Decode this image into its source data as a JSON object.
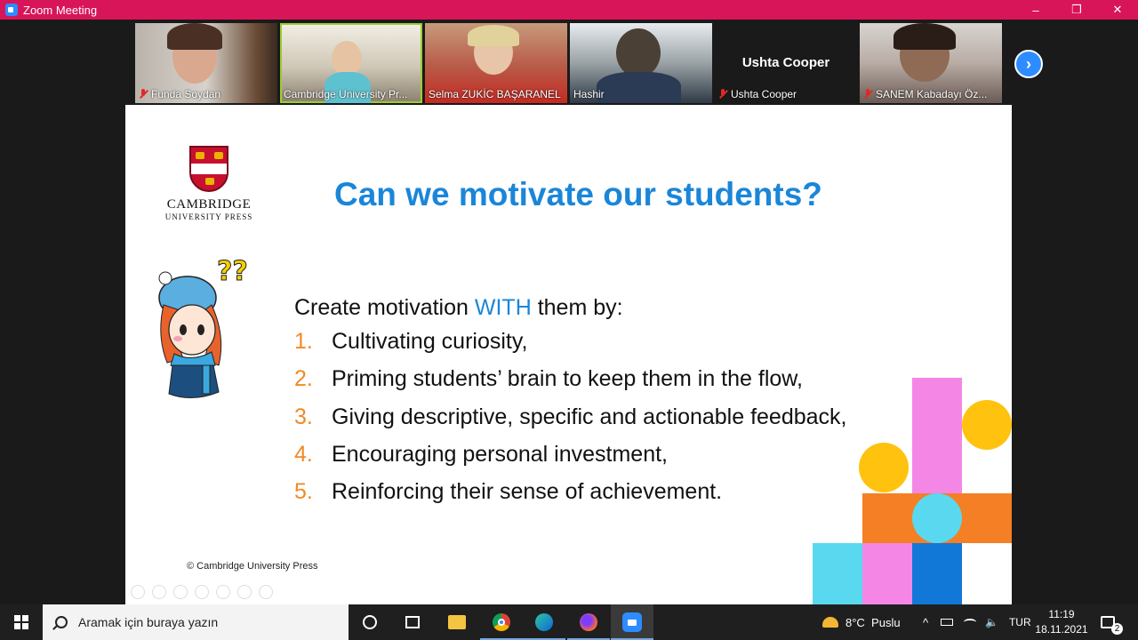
{
  "window": {
    "title": "Zoom Meeting",
    "controls": [
      "–",
      "❐",
      "✕"
    ]
  },
  "participants": [
    {
      "name": "Funda Soydan",
      "muted": true
    },
    {
      "name": "Cambridge University Pr...",
      "muted": false,
      "active": true
    },
    {
      "name": "Selma ZUKİC BAŞARANEL",
      "muted": false
    },
    {
      "name": "Hashir",
      "muted": false
    },
    {
      "name": "Ushta Cooper",
      "muted": true,
      "video_off": true,
      "display_name": "Ushta Cooper"
    },
    {
      "name": "SANEM Kabadayı Öz...",
      "muted": true
    }
  ],
  "next_page_icon": "chevron-right",
  "slide": {
    "logo": {
      "line1": "CAMBRIDGE",
      "line2": "UNIVERSITY PRESS"
    },
    "title": "Can we motivate our students?",
    "intro_before": "Create motivation ",
    "intro_highlight": "WITH",
    "intro_after": " them by:",
    "items": [
      {
        "num": "1.",
        "text": "Cultivating  curiosity,"
      },
      {
        "num": "2.",
        "text": "Priming students’ brain to keep them in the flow,"
      },
      {
        "num": "3.",
        "text": "Giving descriptive, specific and actionable feedback,"
      },
      {
        "num": "4.",
        "text": "Encouraging personal investment,"
      },
      {
        "num": "5.",
        "text": "Reinforcing their sense of achievement."
      }
    ],
    "copyright": "© Cambridge University Press",
    "colors": {
      "title": "#1a86d9",
      "numbers": "#f08a24"
    }
  },
  "taskbar": {
    "search_placeholder": "Aramak için buraya yazın",
    "weather": "8°C  Puslu",
    "language": "TUR",
    "time": "11:19",
    "date": "18.11.2021",
    "notifications": "2"
  }
}
